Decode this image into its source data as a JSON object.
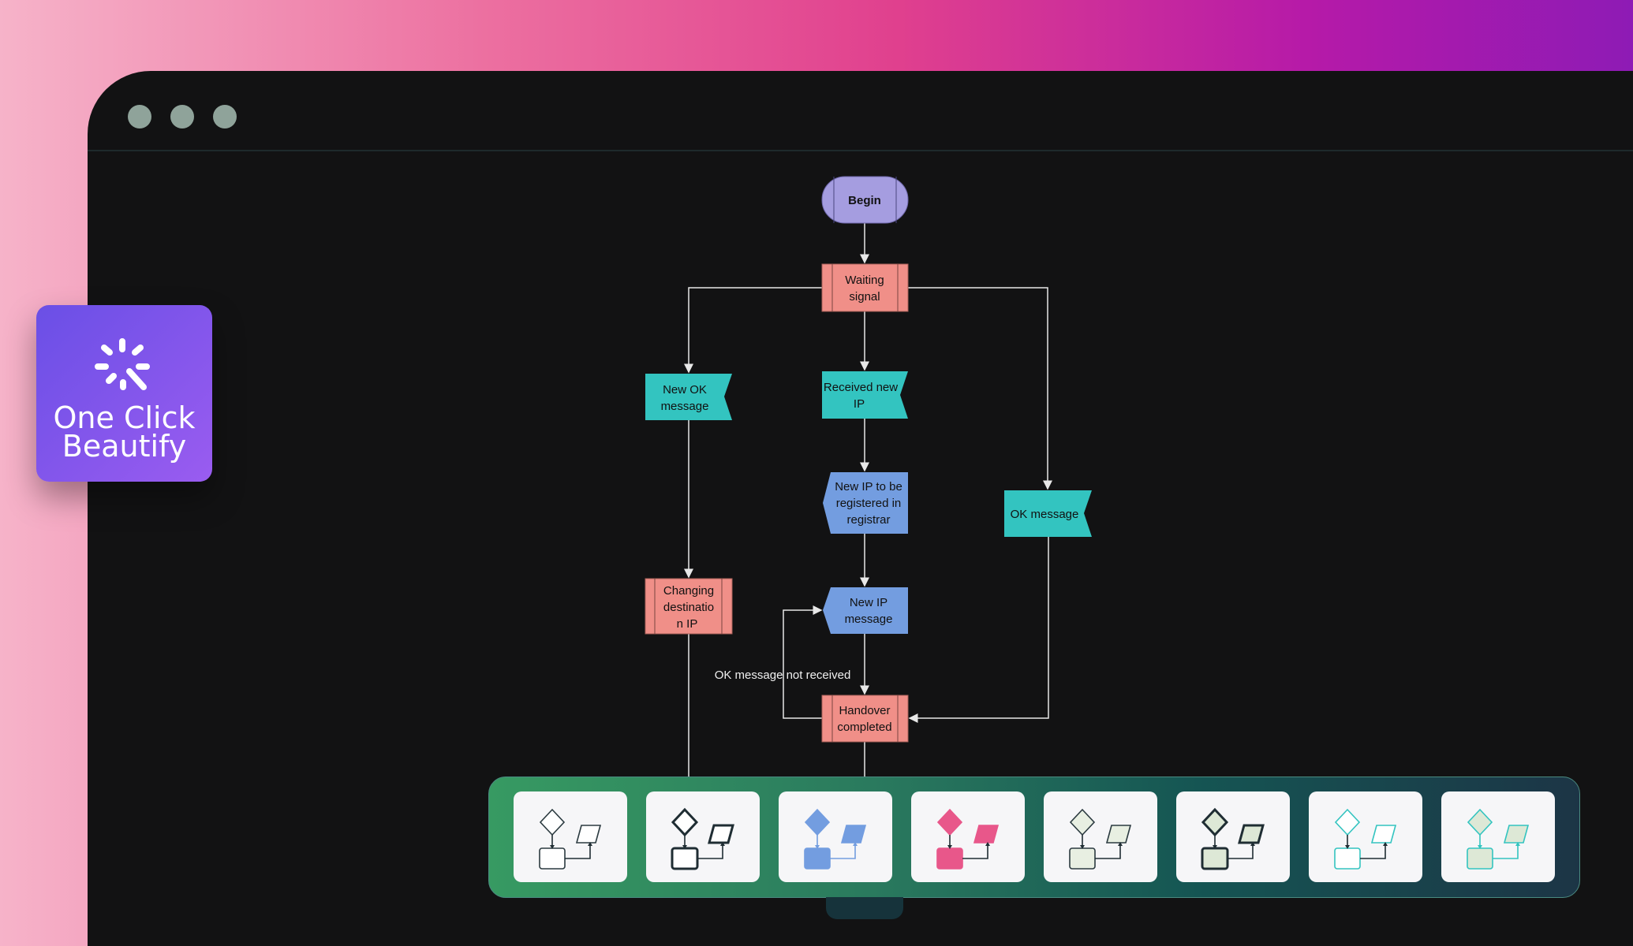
{
  "badge": {
    "title_line1": "One Click",
    "title_line2": "Beautify",
    "icon": "sparkle-wand-icon"
  },
  "window": {
    "controls": [
      "window-dot-1",
      "window-dot-2",
      "window-dot-3"
    ]
  },
  "flowchart": {
    "nodes": {
      "begin": "Begin",
      "waiting_1": "Waiting",
      "waiting_2": "signal",
      "new_ok_1": "New OK",
      "new_ok_2": "message",
      "received_1": "Received new",
      "received_2": "IP",
      "new_ip_reg_1": "New IP to be",
      "new_ip_reg_2": "registered in",
      "new_ip_reg_3": "registrar",
      "ok_message": "OK message",
      "changing_1": "Changing",
      "changing_2": "destinatio",
      "changing_3": "n IP",
      "new_ip_msg_1": "New IP",
      "new_ip_msg_2": "message",
      "handover_1": "Handover",
      "handover_2": "completed"
    },
    "edge_label": "OK message not received",
    "colors": {
      "terminal": "#a59de0",
      "process": "#f08f88",
      "signal": "#33c4c0",
      "data": "#739de0",
      "line": "#e8e8e8"
    }
  },
  "styles_panel": {
    "themes": [
      {
        "name": "outline-thin",
        "stroke": "#2b3a40",
        "fill": "#ffffff"
      },
      {
        "name": "outline-bold",
        "stroke": "#1f2d33",
        "fill": "#ffffff"
      },
      {
        "name": "blue",
        "stroke": "#739de0",
        "fill": "#739de0"
      },
      {
        "name": "pink",
        "stroke": "#e8578a",
        "fill": "#e8578a"
      },
      {
        "name": "pale-green-outline",
        "stroke": "#2b3a40",
        "fill": "#e8efe2"
      },
      {
        "name": "pale-green",
        "stroke": "#1f2d33",
        "fill": "#dde8d6"
      },
      {
        "name": "teal-outline",
        "stroke": "#33c4c0",
        "fill": "#ffffff"
      },
      {
        "name": "pale-green-flat",
        "stroke": "#33c4c0",
        "fill": "#dde8d6"
      }
    ]
  }
}
